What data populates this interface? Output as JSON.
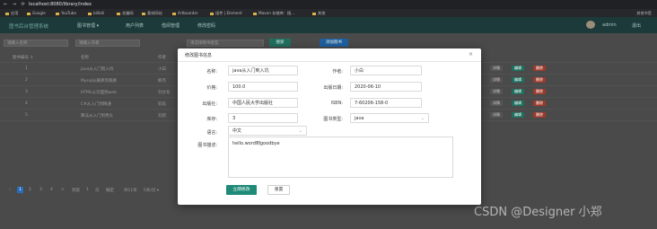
{
  "browser": {
    "nav_glyphs": "← → ⟳",
    "url": "localhost:8080/library/index",
    "bookmarks": [
      "应用",
      "Google",
      "YouTube",
      "bilibili",
      "花瓣网",
      "素材网站",
      "Artboarder",
      "组件 | Element",
      "Maven 存储库：搜...",
      "其他"
    ],
    "bookmarks_right": "其他书签"
  },
  "app": {
    "logo": "图书后台管理系统",
    "nav": [
      "图书管理 ▾",
      "用户列表",
      "借阅管理",
      "修改密码"
    ],
    "user": "admin",
    "logout": "退出",
    "filters": {
      "name_placeholder": "请输入名称",
      "author_placeholder": "请输入作者",
      "type_placeholder": "请选择图书类型",
      "search_label": "搜索",
      "add_label": "添加图书"
    },
    "table": {
      "headers": [
        "图书编号 ↕",
        "名称",
        "作者"
      ],
      "rows": [
        {
          "id": "1",
          "name": "java从入门到入坑",
          "author": "小白"
        },
        {
          "id": "2",
          "name": "Mysql从删库到跑路",
          "author": "枫杰"
        },
        {
          "id": "3",
          "name": "HTML从页面到web",
          "author": "刘文军"
        },
        {
          "id": "4",
          "name": "C#从入门到精通",
          "author": "钦玖"
        },
        {
          "id": "5",
          "name": "算法从入门到秃头",
          "author": "刘新"
        }
      ],
      "ops": {
        "detail": "详情",
        "edit": "编辑",
        "delete": "删除"
      }
    },
    "pager": {
      "pages": [
        "1",
        "2",
        "3",
        "4",
        ">",
        "到第",
        "1",
        "页",
        "确定",
        "共11条",
        "5条/页 ▾"
      ]
    }
  },
  "modal": {
    "title": "修改图书信息",
    "close": "×",
    "fields": {
      "name": {
        "label": "名称:",
        "value": "java从入门到入坑"
      },
      "author": {
        "label": "作者:",
        "value": "小白"
      },
      "price": {
        "label": "价格:",
        "value": "100.0"
      },
      "pubdate": {
        "label": "出版日期:",
        "value": "2020-06-10"
      },
      "publisher": {
        "label": "出版社:",
        "value": "中国人民大学出版社"
      },
      "isbn": {
        "label": "ISBN:",
        "value": "7-60206-158-0"
      },
      "stock": {
        "label": "库存:",
        "value": "3"
      },
      "booktype": {
        "label": "图书类型:",
        "value": "java"
      },
      "language": {
        "label": "语言:",
        "value": "中文"
      },
      "desc": {
        "label": "图书描述:",
        "value": "hello.word到goodbye"
      }
    },
    "submit": "立即修改",
    "reset": "重置"
  },
  "watermark": "CSDN @Designer 小郑"
}
